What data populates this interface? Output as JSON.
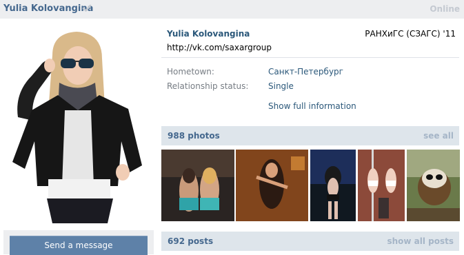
{
  "header": {
    "name": "Yulia Kolovangina",
    "online_status": "Online"
  },
  "sidebar": {
    "send_message_label": "Send a message"
  },
  "profile": {
    "name": "Yulia Kolovangina",
    "university": "РАНХиГС (СЗАГС) '11",
    "status": "http://vk.com/saxargroup",
    "info": [
      {
        "label": "Hometown:",
        "value": "Санкт-Петербург"
      },
      {
        "label": "Relationship status:",
        "value": "Single"
      }
    ],
    "show_full_label": "Show full information"
  },
  "photos": {
    "title": "988 photos",
    "link": "see all"
  },
  "posts": {
    "title": "692 posts",
    "link": "show all posts"
  },
  "colors": {
    "link": "#2b587a",
    "header_bg": "#edeef0",
    "section_bg": "#dee5eb",
    "button_bg": "#5e81a8"
  }
}
